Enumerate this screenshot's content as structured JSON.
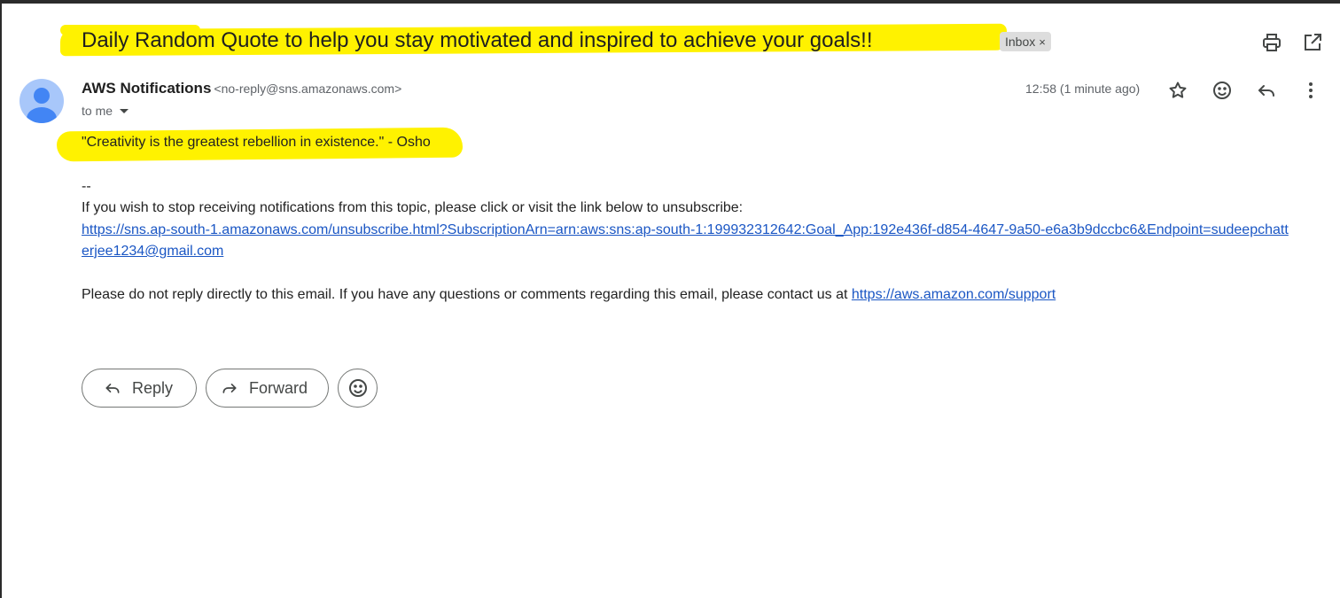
{
  "email": {
    "subject": "Daily Random Quote to help you stay motivated and inspired to achieve your goals!!",
    "label": "Inbox",
    "label_remove": "×",
    "sender_name": "AWS Notifications",
    "sender_email": "<no-reply@sns.amazonaws.com>",
    "recipient": "to me",
    "timestamp": "12:58 (1 minute ago)",
    "body": {
      "quote": "\"Creativity is the greatest rebellion in existence.\" - Osho",
      "separator": "--",
      "unsubscribe_text": "If you wish to stop receiving notifications from this topic, please click or visit the link below to unsubscribe:",
      "unsubscribe_link": "https://sns.ap-south-1.amazonaws.com/unsubscribe.html?SubscriptionArn=arn:aws:sns:ap-south-1:199932312642:Goal_App:192e436f-d854-4647-9a50-e6a3b9dccbc6&Endpoint=sudeepchatterjee1234@gmail.com",
      "contact_text": "Please do not reply directly to this email. If you have any questions or comments regarding this email, please contact us at ",
      "support_link": "https://aws.amazon.com/support"
    }
  },
  "actions": {
    "reply_label": "Reply",
    "forward_label": "Forward"
  },
  "icons": {
    "top": [
      "print-icon",
      "open-in-new-window-icon"
    ],
    "header": [
      "star-icon",
      "emoji-reaction-icon",
      "reply-icon",
      "more-vert-icon"
    ],
    "avatar": "default-avatar-icon"
  },
  "colors": {
    "highlight": "#fff200",
    "link": "#1a56c4",
    "avatar_bg": "#a8c7fa",
    "avatar_fg": "#4285f4",
    "chip_bg": "#dddddd"
  }
}
